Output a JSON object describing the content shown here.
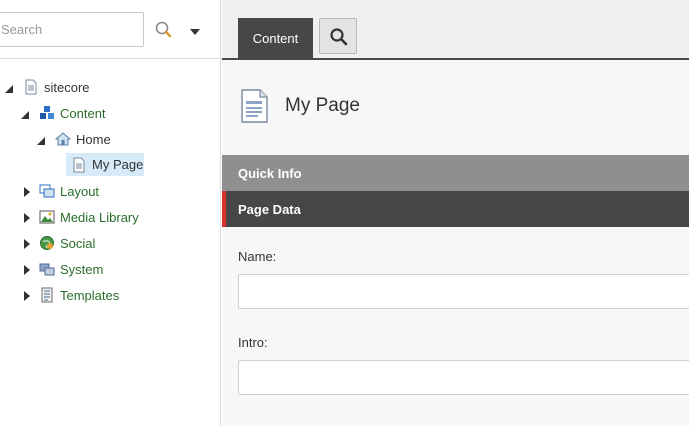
{
  "search": {
    "placeholder": "Search",
    "value": ""
  },
  "tree": {
    "items": [
      {
        "label": "sitecore",
        "icon": "document-icon",
        "expanded": true
      },
      {
        "label": "Content",
        "icon": "cubes-icon",
        "expanded": true
      },
      {
        "label": "Home",
        "icon": "home-icon",
        "expanded": true
      },
      {
        "label": "My Page",
        "icon": "document-icon",
        "selected": true
      },
      {
        "label": "Layout",
        "icon": "layout-icon",
        "expanded": false
      },
      {
        "label": "Media Library",
        "icon": "image-icon",
        "expanded": false
      },
      {
        "label": "Social",
        "icon": "globe-icon",
        "expanded": false
      },
      {
        "label": "System",
        "icon": "system-icon",
        "expanded": false
      },
      {
        "label": "Templates",
        "icon": "templates-icon",
        "expanded": false
      }
    ]
  },
  "editor": {
    "tabs": [
      {
        "label": "Content",
        "active": true
      }
    ],
    "item_title": "My Page",
    "sections": {
      "quick_info": "Quick Info",
      "page_data": "Page Data"
    },
    "fields": {
      "name": {
        "label": "Name:",
        "value": ""
      },
      "intro": {
        "label": "Intro:",
        "value": ""
      }
    }
  },
  "colors": {
    "accent": "#d9312b",
    "tab_active": "#474747",
    "tree_text": "#2b6e2b",
    "selection": "#d6ebf7"
  }
}
